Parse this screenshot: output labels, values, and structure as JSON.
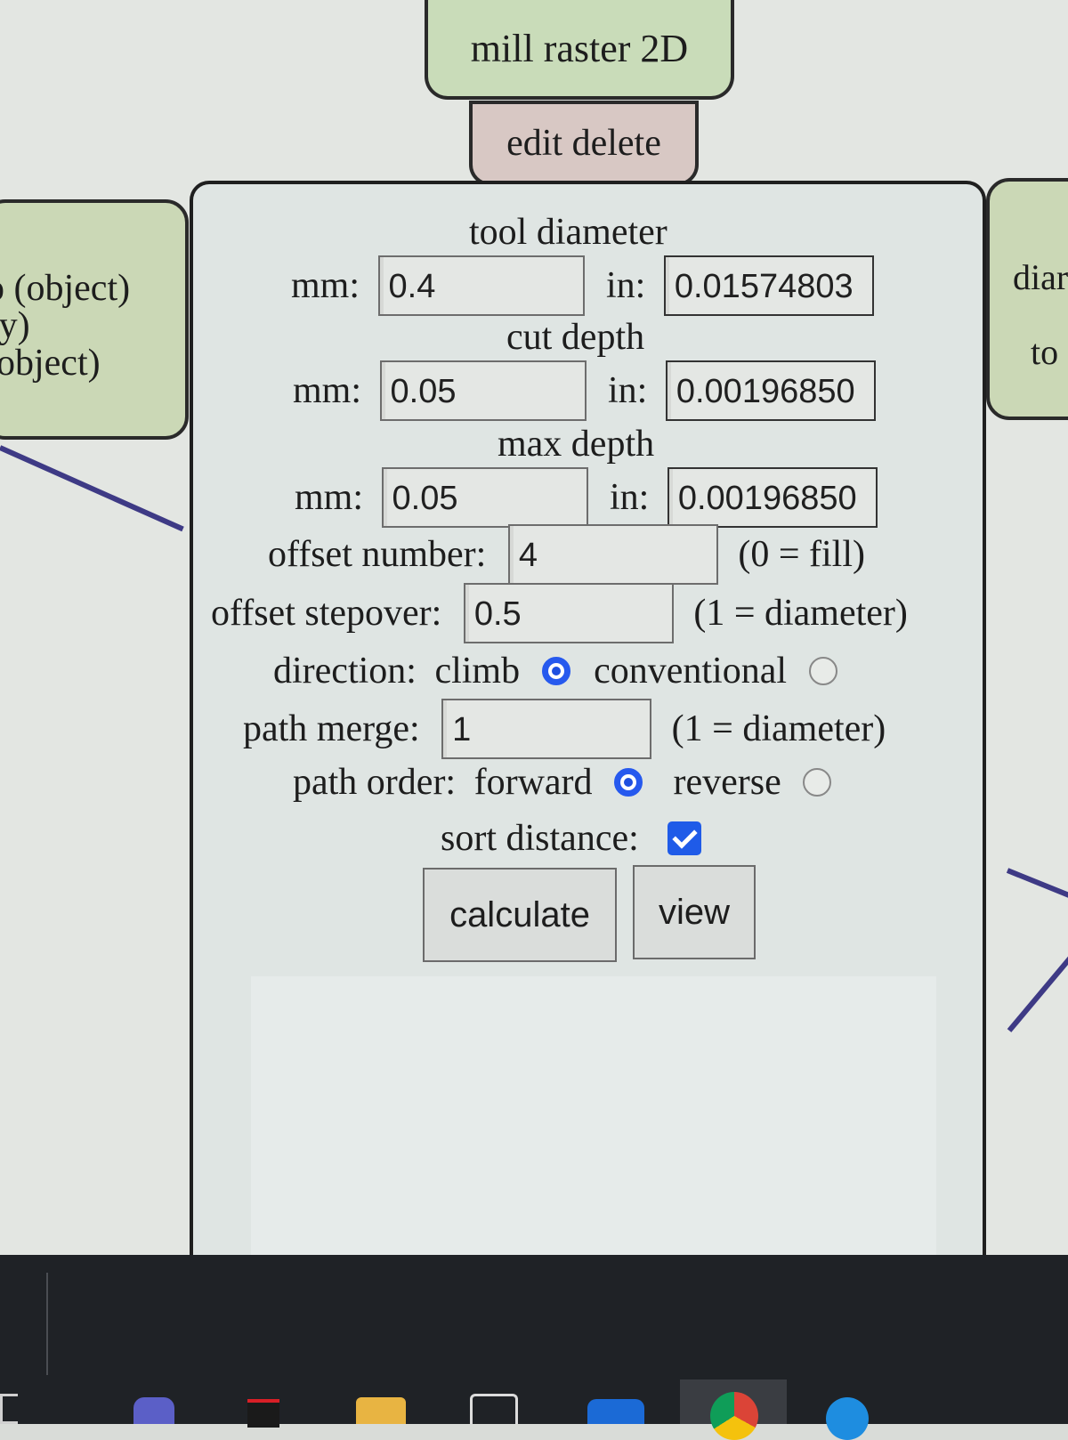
{
  "title_node": {
    "label": "mill raster 2D"
  },
  "action_node": {
    "label": "edit delete"
  },
  "left_node": {
    "lines": [
      "o (object)",
      "ay)",
      "object)"
    ]
  },
  "right_node": {
    "lines": [
      "diar",
      "to"
    ]
  },
  "form": {
    "tool_diameter": {
      "heading": "tool diameter",
      "mm_label": "mm:",
      "mm_value": "0.4",
      "in_label": "in:",
      "in_value": "0.01574803"
    },
    "cut_depth": {
      "heading": "cut depth",
      "mm_label": "mm:",
      "mm_value": "0.05",
      "in_label": "in:",
      "in_value": "0.00196850"
    },
    "max_depth": {
      "heading": "max depth",
      "mm_label": "mm:",
      "mm_value": "0.05",
      "in_label": "in:",
      "in_value": "0.00196850"
    },
    "offset_number": {
      "label": "offset number:",
      "value": "4",
      "hint": "(0 = fill)"
    },
    "offset_stepover": {
      "label": "offset stepover:",
      "value": "0.5",
      "hint": "(1 = diameter)"
    },
    "direction": {
      "label": "direction:",
      "option_a": "climb",
      "option_b": "conventional",
      "selected": "climb"
    },
    "path_merge": {
      "label": "path merge:",
      "value": "1",
      "hint": "(1 = diameter)"
    },
    "path_order": {
      "label": "path order:",
      "option_a": "forward",
      "option_b": "reverse",
      "selected": "forward"
    },
    "sort_distance": {
      "label": "sort distance:",
      "checked": true
    },
    "buttons": {
      "calculate": "calculate",
      "view": "view"
    }
  },
  "colors": {
    "node_green": "#c9dcb9",
    "node_rose": "#d8c8c4",
    "accent_blue": "#2659ee",
    "wire": "#3e3a85"
  }
}
